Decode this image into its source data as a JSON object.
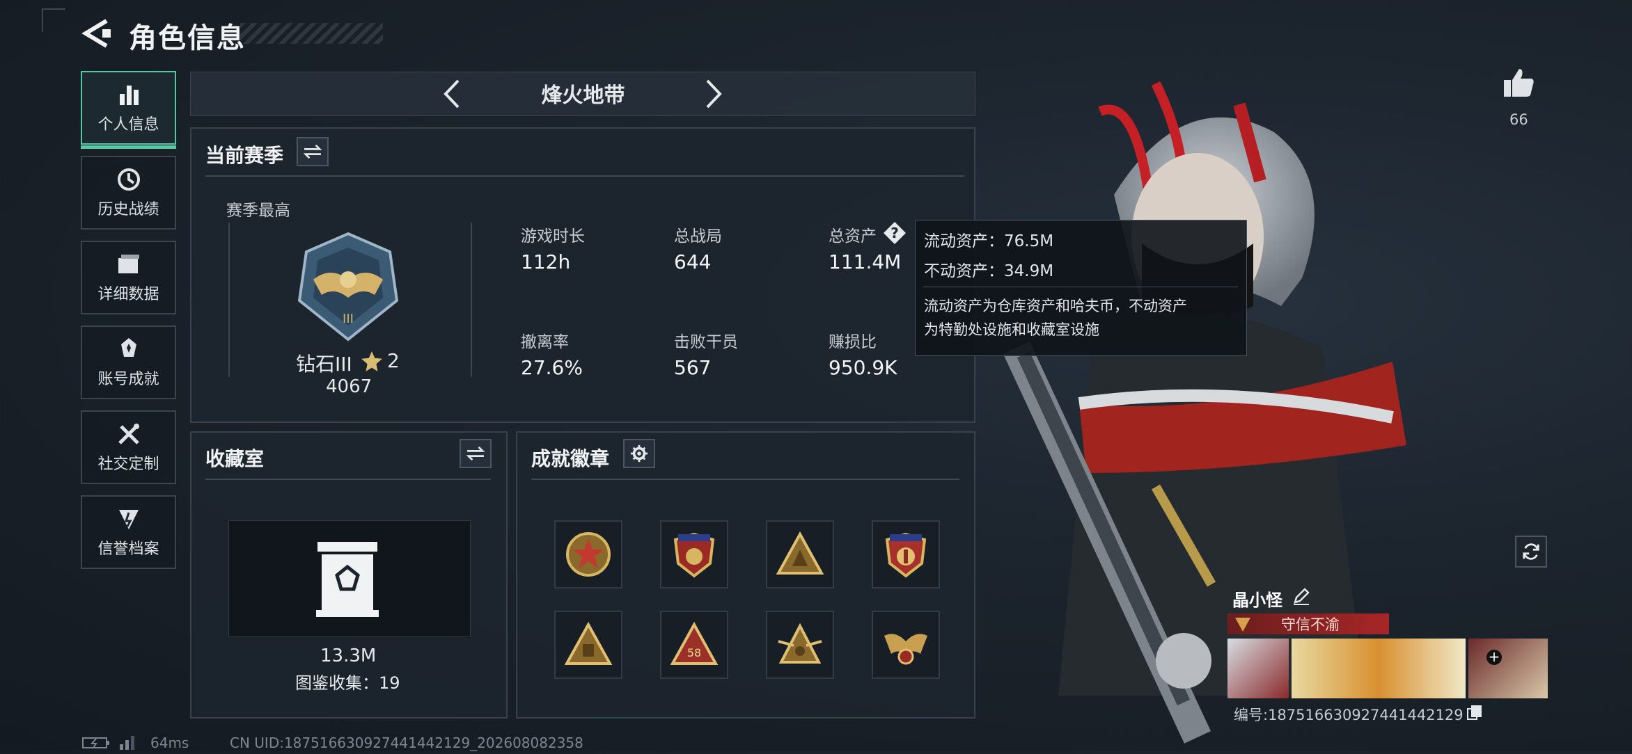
{
  "header": {
    "title": "角色信息"
  },
  "sidebar": {
    "items": [
      {
        "label": "个人信息",
        "icon": "bar-chart-icon",
        "active": true
      },
      {
        "label": "历史战绩",
        "icon": "history-clock-icon"
      },
      {
        "label": "详细数据",
        "icon": "folder-icon"
      },
      {
        "label": "账号成就",
        "icon": "achievement-icon"
      },
      {
        "label": "社交定制",
        "icon": "tools-icon"
      },
      {
        "label": "信誉档案",
        "icon": "reputation-icon"
      }
    ]
  },
  "mode": {
    "label": "烽火地带"
  },
  "season": {
    "title": "当前赛季",
    "subtitle": "赛季最高",
    "rank_name": "钻石III",
    "rank_stars": "2",
    "rank_score": "4067",
    "stats": [
      {
        "label": "游戏时长",
        "value": "112h"
      },
      {
        "label": "总战局",
        "value": "644"
      },
      {
        "label": "总资产",
        "value": "111.4M"
      },
      {
        "label": "撤离率",
        "value": "27.6%"
      },
      {
        "label": "击败干员",
        "value": "567"
      },
      {
        "label": "赚损比",
        "value": "950.9K"
      }
    ]
  },
  "tooltip": {
    "liquid": "流动资产：76.5M",
    "fixed": "不动资产：34.9M",
    "desc_line1": "流动资产为仓库资产和哈夫币，不动资产",
    "desc_line2": "为特勤处设施和收藏室设施"
  },
  "collection": {
    "title": "收藏室",
    "value": "13.3M",
    "count_text": "图鉴收集：19"
  },
  "badges": {
    "title": "成就徽章",
    "items": [
      "star-medal-icon",
      "shield-star-icon",
      "triangle-badge-icon",
      "shield-eagle-icon",
      "triangle-badge-icon",
      "triangle-58-icon",
      "triangle-winged-icon",
      "eagle-crest-icon"
    ]
  },
  "profile": {
    "likes": "66",
    "player_name": "晶小怪",
    "reputation": "守信不渝",
    "id_text": "编号:1875166309274414421​29"
  },
  "footer": {
    "ping": "64ms",
    "uid": "CN UID:187516630927441442129_202608082358"
  },
  "colors": {
    "accent": "#56c9a0",
    "gold": "#c9a24b",
    "rep_red": "#a82626"
  }
}
